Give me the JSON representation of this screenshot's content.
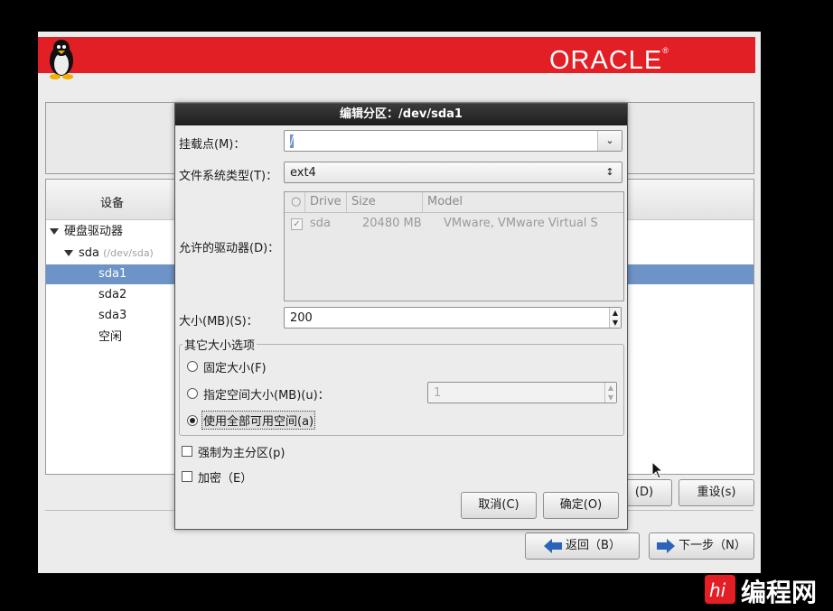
{
  "banner": {
    "brand": "ORACLE",
    "trademark": "®"
  },
  "tree": {
    "header": "设备",
    "items": [
      {
        "label": "硬盘驱动器",
        "sub": ""
      },
      {
        "label": "sda",
        "sub": "(/dev/sda)"
      },
      {
        "label": "sda1",
        "sub": ""
      },
      {
        "label": "sda2",
        "sub": ""
      },
      {
        "label": "sda3",
        "sub": ""
      },
      {
        "label": "空闲",
        "sub": ""
      }
    ]
  },
  "actions": {
    "delete_label": "(D)",
    "reset_label": "重设(s)",
    "back_label": "返回（B）",
    "next_label": "下一步（N）"
  },
  "dialog": {
    "title": "编辑分区：/dev/sda1",
    "mount_label": "挂载点(M)：",
    "mount_value": "/",
    "fstype_label": "文件系统类型(T)：",
    "fstype_value": "ext4",
    "drives_label": "允许的驱动器(D)：",
    "drive_columns": [
      "Drive",
      "Size",
      "Model"
    ],
    "drive_rows": [
      {
        "drive": "sda",
        "size": "20480 MB",
        "model": "VMware, VMware Virtual S",
        "checked": true
      }
    ],
    "size_label": "大小(MB)(S)：",
    "size_value": "200",
    "size_options_label": "其它大小选项",
    "opt_fixed": "固定大小(F)",
    "opt_upto": "指定空间大小(MB)(u)：",
    "opt_upto_value": "1",
    "opt_fill": "使用全部可用空间(a)",
    "selected_option": "fill",
    "force_primary": "强制为主分区(p)",
    "encrypt": "加密（E）",
    "cancel_label": "取消(C)",
    "ok_label": "确定(O)"
  },
  "watermark": {
    "text": "编程网"
  }
}
